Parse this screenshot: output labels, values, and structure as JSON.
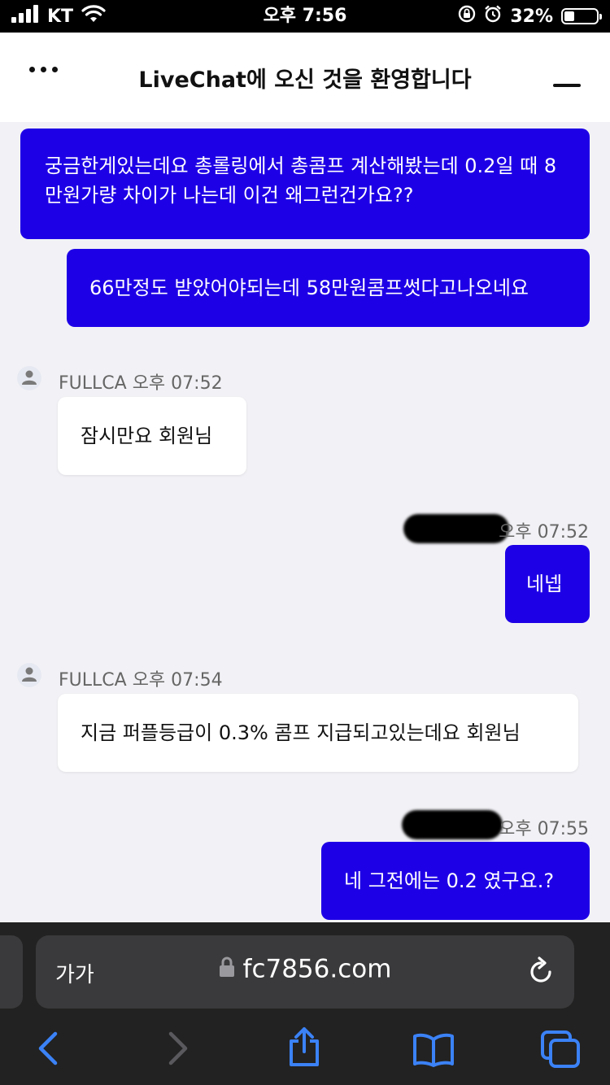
{
  "status_bar": {
    "carrier": "KT",
    "time": "오후 7:56",
    "battery": "32%",
    "battery_level": 0.32
  },
  "header": {
    "title": "LiveChat에 오신 것을 환영합니다"
  },
  "messages": [
    {
      "text": "궁금한게있는데요 총롤링에서 총콤프 계산해봤는데 0.2일 때 8만원가량 차이가 나는데 이건 왜그런건가요??"
    },
    {
      "text": "66만정도 받았어야되는데 58만원콤프썻다고나오네요"
    },
    {
      "sender": "FULLCA",
      "time": "오후 07:52",
      "text": "잠시만요 회원님"
    },
    {
      "time": "오후 07:52",
      "text": "네넵"
    },
    {
      "sender": "FULLCA",
      "time": "오후 07:54",
      "text": "지금 퍼플등급이 0.3% 콤프 지급되고있는데요 회원님"
    },
    {
      "time": "오후 07:55",
      "text": "네 그전에는 0.2 였구요.?"
    }
  ],
  "browser": {
    "text_size": "가가",
    "url": "fc7856.com"
  },
  "colors": {
    "user_bubble": "#1e00e6",
    "toolbar_icon": "#3b82f6",
    "disabled_icon": "#5a5a5e"
  }
}
